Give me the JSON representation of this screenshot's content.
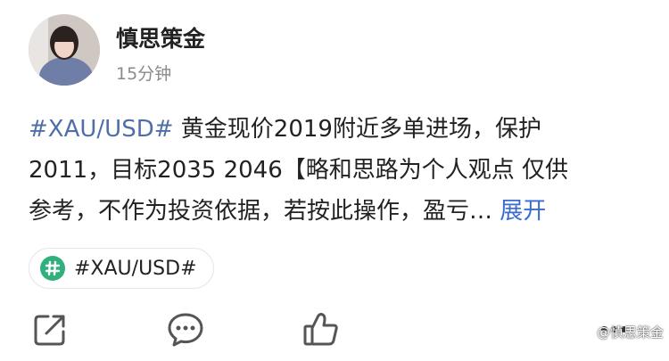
{
  "author": {
    "name": "慎思策金",
    "time": "15分钟"
  },
  "post": {
    "hashtag": "#XAU/USD#",
    "text_line1": " 黄金现价2019附近多单进场，保护",
    "text_line2": "2011，目标2035 2046【略和思路为个人观点 仅供",
    "text_line3": "参考，不作为投资依据，若按此操作，盈亏…",
    "expand_label": "展开"
  },
  "topic": {
    "label": "#XAU/USD#"
  },
  "actions": {
    "share_icon": "share-icon",
    "comment_icon": "comment-icon",
    "like_icon": "thumbs-up-icon",
    "more_icon": "more-icon"
  },
  "watermark": "@慎思策金",
  "colors": {
    "hashtag": "#4f6fa8",
    "expand": "#3a6bd0",
    "topic_icon": "#2fb07d"
  }
}
